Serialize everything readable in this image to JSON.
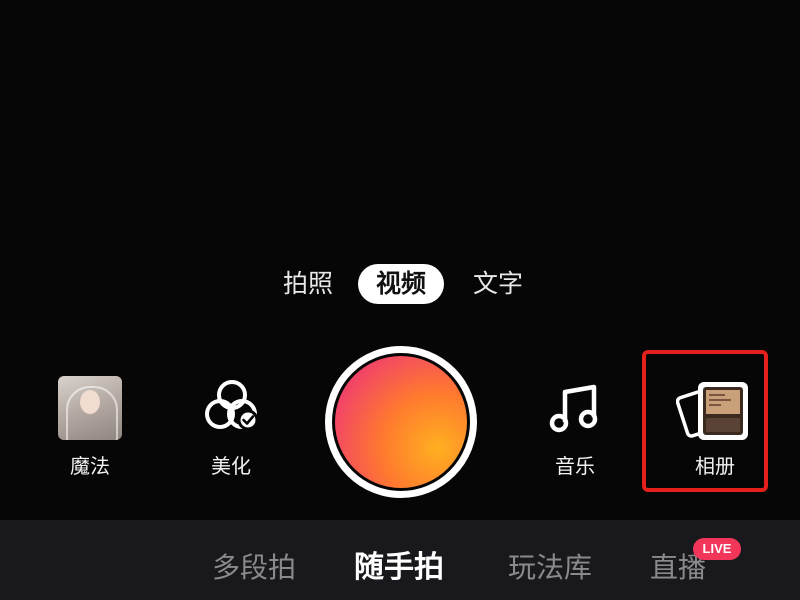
{
  "mode_tabs": [
    {
      "label": "拍照",
      "selected": false
    },
    {
      "label": "视频",
      "selected": true
    },
    {
      "label": "文字",
      "selected": false
    }
  ],
  "tools": {
    "magic": {
      "label": "魔法",
      "icon": "magic-thumbnail"
    },
    "beauty": {
      "label": "美化",
      "icon": "beauty-icon"
    },
    "music": {
      "label": "音乐",
      "icon": "music-note-icon"
    },
    "album": {
      "label": "相册",
      "icon": "album-icon",
      "highlighted": true,
      "highlight_color": "#e3201c"
    }
  },
  "shutter": {
    "icon": "record-button",
    "ring_color": "#ffffff",
    "gradient": [
      "#ea3566",
      "#ffb020"
    ]
  },
  "bottom_tabs": [
    {
      "label": "多段拍",
      "selected": false
    },
    {
      "label": "随手拍",
      "selected": true
    },
    {
      "label": "玩法库",
      "selected": false
    },
    {
      "label": "直播",
      "selected": false
    }
  ],
  "live_badge": {
    "label": "LIVE",
    "color": "#f2365a"
  }
}
